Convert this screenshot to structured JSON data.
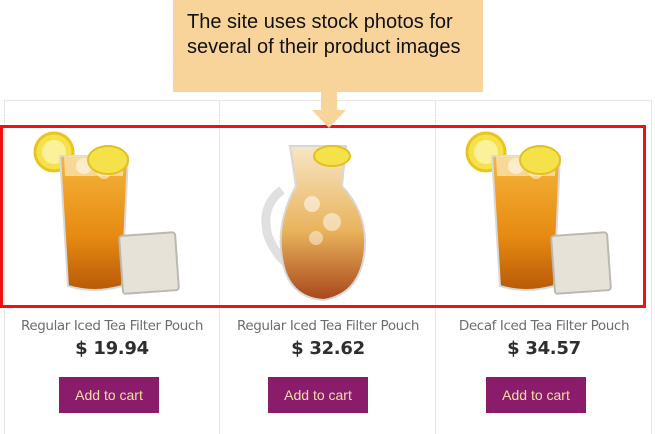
{
  "annotation": {
    "text": "The site uses stock photos for several of their product images",
    "callout_color": "#f8d49a",
    "highlight_color": "#ee1111"
  },
  "theme": {
    "button_bg": "#8a1c6b",
    "button_text": "#f3e0a6"
  },
  "products": [
    {
      "name": "Regular Iced Tea Filter Pouch",
      "price": "$ 19.94",
      "button_label": "Add to cart",
      "image": "iced-tea-glass-with-filter-pouch"
    },
    {
      "name": "Regular Iced Tea Filter Pouch",
      "price": "$ 32.62",
      "button_label": "Add to cart",
      "image": "iced-tea-pitcher"
    },
    {
      "name": "Decaf Iced Tea Filter Pouch",
      "price": "$ 34.57",
      "button_label": "Add to cart",
      "image": "iced-tea-glass-with-filter-pouch"
    }
  ]
}
